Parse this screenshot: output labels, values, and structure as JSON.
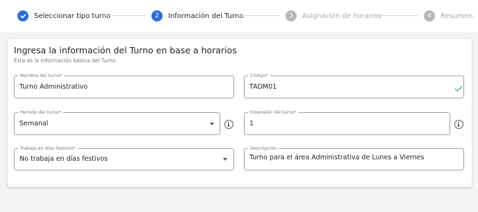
{
  "stepper": {
    "steps": [
      {
        "label": "Seleccionar tipo turno",
        "number": "1",
        "state": "done"
      },
      {
        "label": "Información del Turno",
        "number": "2",
        "state": "active"
      },
      {
        "label": "Asignación de horarios",
        "number": "3",
        "state": "pending"
      },
      {
        "label": "Resumen",
        "number": "4",
        "state": "pending"
      }
    ]
  },
  "form": {
    "title": "Ingresa la información del Turno en base a horarios",
    "subtitle": "Esta es la información básica del Turno",
    "nombre": {
      "label": "Nombre del turno*",
      "value": "Turno Administrativo"
    },
    "codigo": {
      "label": "Código*",
      "value": "TADM01"
    },
    "periodo": {
      "label": "Período del turno*",
      "value": "Semanal"
    },
    "extension": {
      "label": "Extensión del turno*",
      "value": "1"
    },
    "festivos": {
      "label": "Trabajo en días festivos*",
      "value": "No trabaja en días festivos"
    },
    "descripcion": {
      "label": "Descripción",
      "value": "Turno para el área Administrativa de Lunes a Viernes"
    }
  },
  "colors": {
    "accent": "#2d6bd6",
    "valid": "#3cb878",
    "pending": "#b6b6b6"
  },
  "icons": [
    "check-icon",
    "chevron-down-icon",
    "info-icon"
  ]
}
